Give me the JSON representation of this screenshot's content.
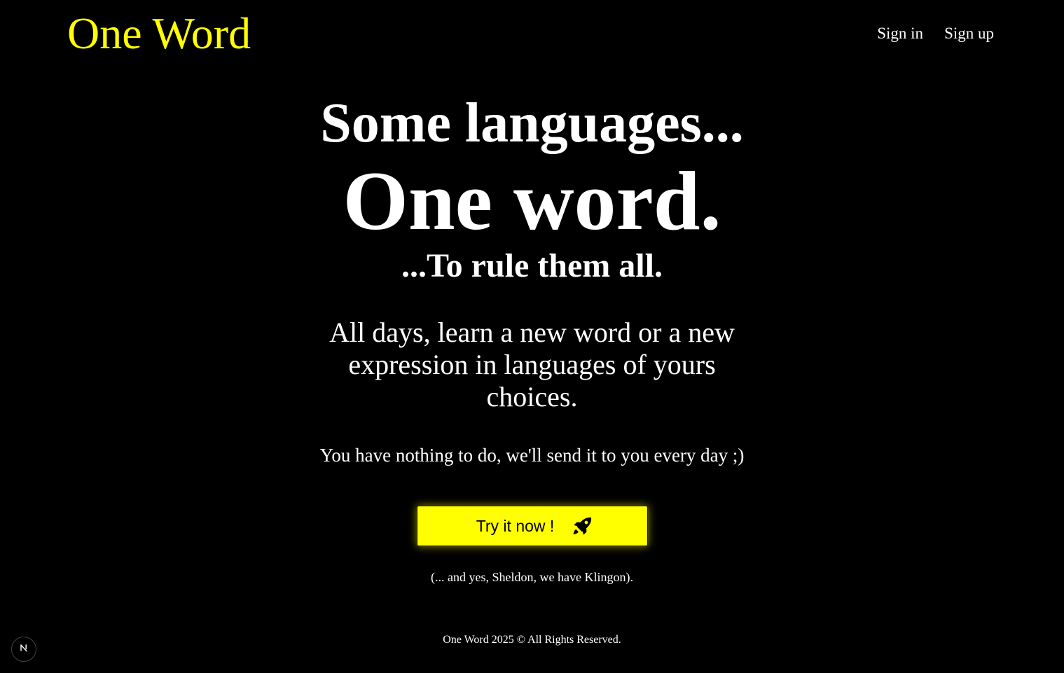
{
  "header": {
    "logo": "One Word",
    "nav": {
      "sign_in": "Sign in",
      "sign_up": "Sign up"
    }
  },
  "hero": {
    "line1": "Some languages...",
    "line2": "One word.",
    "line3": "...To rule them all.",
    "description": "All days, learn a new word or a new expression in languages of yours choices.",
    "note": "You have nothing to do, we'll send it to you every day ;)",
    "cta_label": "Try it now !",
    "cta_icon": "rocket-icon",
    "klingon": "(... and yes, Sheldon, we have Klingon)."
  },
  "footer": {
    "text": "One Word 2025 © All Rights Reserved."
  },
  "dev_badge": {
    "icon": "nextjs-icon",
    "letter": "N"
  },
  "colors": {
    "background": "#000000",
    "accent": "#ffff00",
    "text": "#ffffff"
  }
}
